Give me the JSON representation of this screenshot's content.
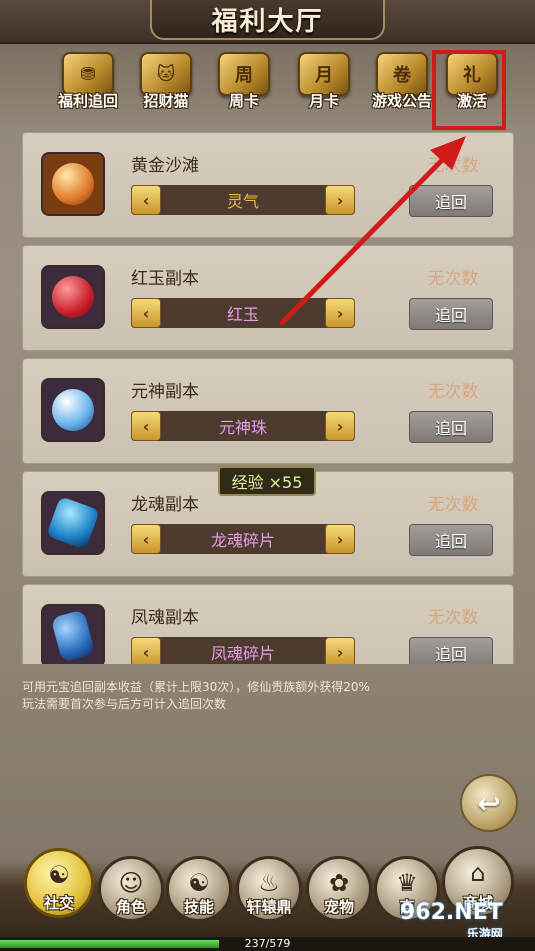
{
  "title": "福利大厅",
  "tabs": [
    {
      "label": "福利追回",
      "icon": "treasure-chest-icon",
      "glyph": "⛃"
    },
    {
      "label": "招财猫",
      "icon": "lucky-cat-icon",
      "glyph": "🐱"
    },
    {
      "label": "周卡",
      "icon": "weekly-card-icon",
      "glyph": "周"
    },
    {
      "label": "月卡",
      "icon": "monthly-card-icon",
      "glyph": "月"
    },
    {
      "label": "游戏公告",
      "icon": "scroll-icon",
      "glyph": "卷"
    },
    {
      "label": "激活",
      "icon": "gift-box-icon",
      "glyph": "礼"
    }
  ],
  "rows": [
    {
      "name": "黄金沙滩",
      "reward": "灵气",
      "status": "无次数",
      "button": "追回",
      "reward_color": "#f3b640",
      "gem_color": "#e07a2a"
    },
    {
      "name": "红玉副本",
      "reward": "红玉",
      "status": "无次数",
      "button": "追回",
      "reward_color": "#e79ce8",
      "gem_color": "#c81e2a"
    },
    {
      "name": "元神副本",
      "reward": "元神珠",
      "status": "无次数",
      "button": "追回",
      "reward_color": "#e79ce8",
      "gem_color": "#6fb7f0"
    },
    {
      "name": "龙魂副本",
      "reward": "龙魂碎片",
      "status": "无次数",
      "button": "追回",
      "reward_color": "#e79ce8",
      "gem_color": "#1e84c8"
    },
    {
      "name": "凤魂副本",
      "reward": "凤魂碎片",
      "status": "无次数",
      "button": "追回",
      "reward_color": "#e79ce8",
      "gem_color": "#2a6fc0"
    }
  ],
  "exp_tooltip": "经验 ×55",
  "footnote": {
    "line1": "可用元宝追回副本收益（累计上限30次），修仙贵族额外获得20%",
    "line2": "玩法需要首次参与后方可计入追回次数"
  },
  "return_icon": "return-arrow-icon",
  "bottom_nav": [
    {
      "label": "社交",
      "icon": "social-icon",
      "glyph": "☯"
    },
    {
      "label": "角色",
      "icon": "character-icon",
      "glyph": "☺"
    },
    {
      "label": "技能",
      "icon": "skill-book-icon",
      "glyph": "☯"
    },
    {
      "label": "轩辕鼎",
      "icon": "cauldron-icon",
      "glyph": "♨"
    },
    {
      "label": "宠物",
      "icon": "pet-icon",
      "glyph": "✿"
    },
    {
      "label": "商",
      "icon": "merchant-icon",
      "glyph": "♛"
    },
    {
      "label": "商城",
      "icon": "shop-icon",
      "glyph": "⌂"
    }
  ],
  "progress": {
    "text": "237/579",
    "current": 237,
    "max": 579
  },
  "watermark": {
    "main": "962.NET",
    "sub": "乐游网"
  }
}
